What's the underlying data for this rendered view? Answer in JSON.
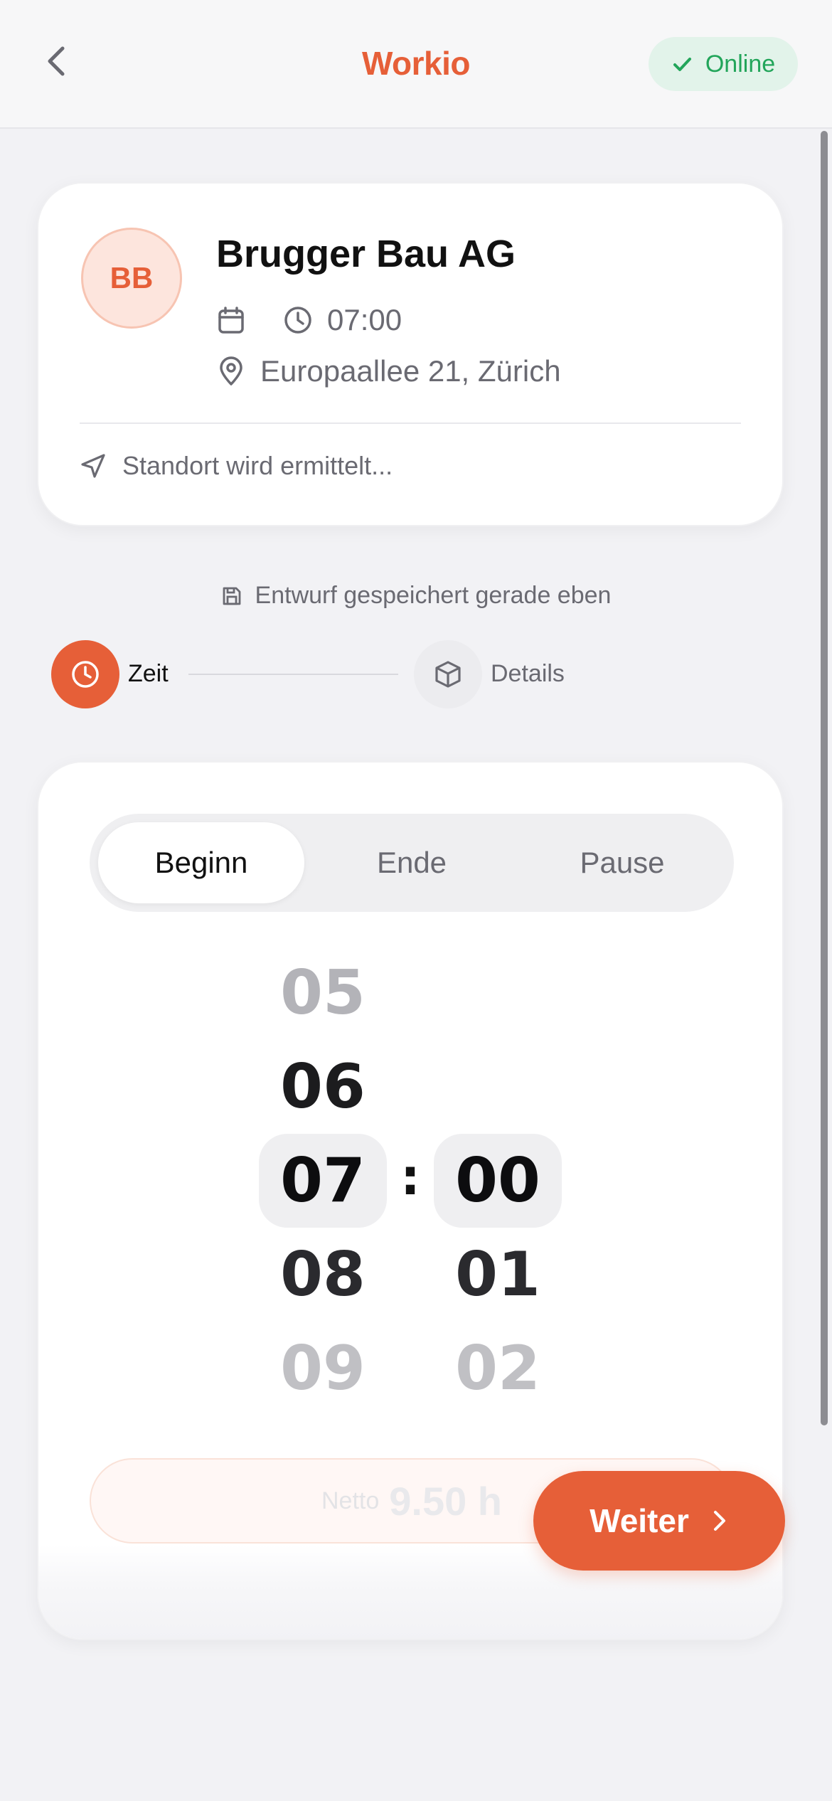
{
  "header": {
    "title": "Workio",
    "status": "Online",
    "accent": "#e65f38",
    "status_color": "#22a55a"
  },
  "job": {
    "initials": "BB",
    "company": "Brugger Bau AG",
    "time": "07:00",
    "address": "Europaallee 21, Zürich",
    "location_status": "Standort wird ermittelt..."
  },
  "draft_status": "Entwurf gespeichert gerade eben",
  "steps": [
    {
      "label": "Zeit",
      "icon": "clock-icon",
      "active": true
    },
    {
      "label": "Details",
      "icon": "box-icon",
      "active": false
    }
  ],
  "tabs": [
    "Beginn",
    "Ende",
    "Pause"
  ],
  "active_tab": "Beginn",
  "picker": {
    "hours": [
      "05",
      "06",
      "07",
      "08",
      "09"
    ],
    "minutes": [
      "00",
      "01",
      "02"
    ],
    "selected_hour": "07",
    "selected_minute": "00",
    "separator": ":"
  },
  "net": {
    "label": "Netto",
    "value": "9.50 h"
  },
  "next_button": "Weiter"
}
